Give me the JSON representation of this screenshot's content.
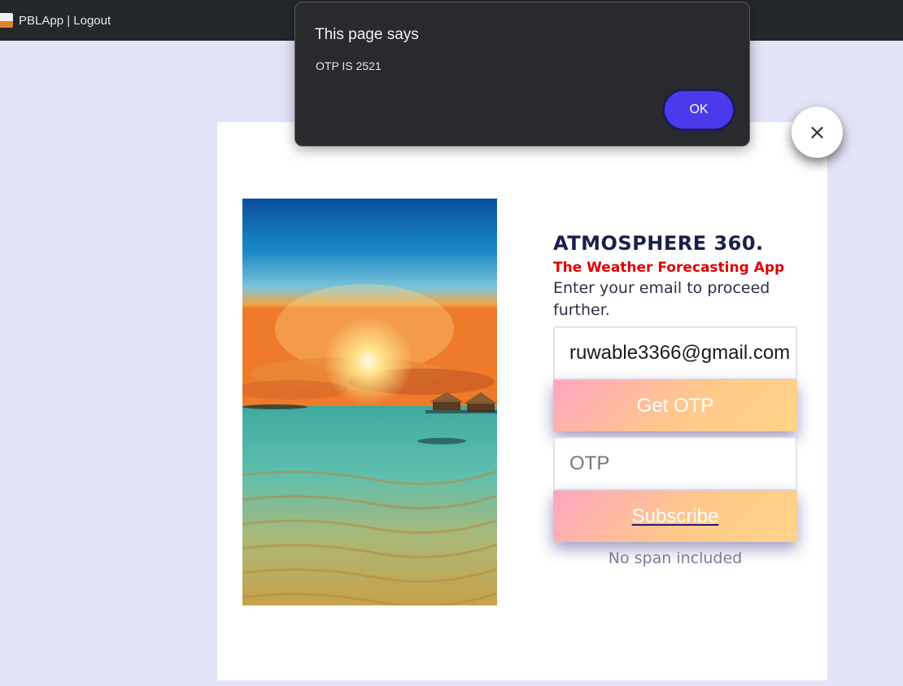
{
  "browser": {
    "tab_title": "PBLApp | Logout"
  },
  "dialog": {
    "title": "This page says",
    "message": "OTP IS 2521",
    "ok_label": "OK"
  },
  "close_button": {
    "label": "×"
  },
  "hero": {
    "brand": "ATMOSPHERE 360.",
    "tagline": "The Weather Forecasting App",
    "instructions": "Enter your email to proceed further."
  },
  "form": {
    "email_value": "ruwable3366@gmail.com",
    "get_otp_label": "Get OTP",
    "otp_placeholder": "OTP",
    "subscribe_label": "Subscribe",
    "note": "No span included"
  },
  "colors": {
    "page_background": "#e4e4f8",
    "brand": "#1b1f4a",
    "tagline": "#e00000",
    "dialog_background": "#292a2d",
    "ok_button": "#4a3aec"
  }
}
